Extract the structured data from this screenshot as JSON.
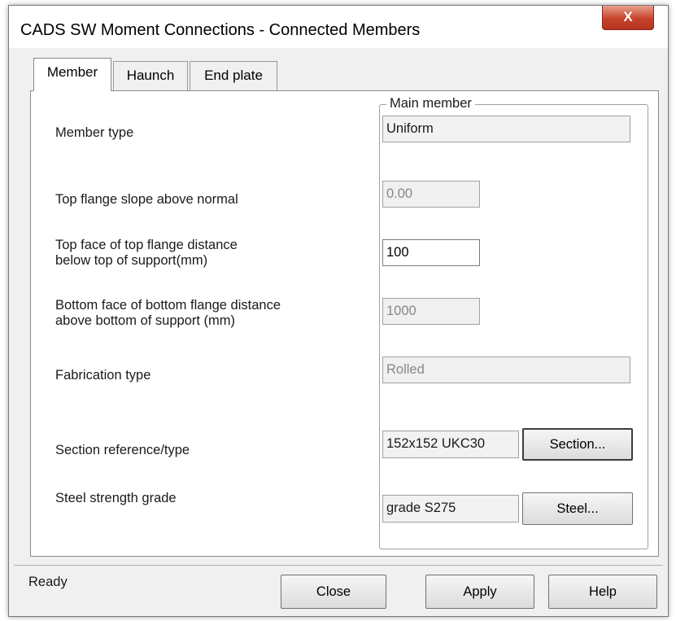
{
  "window": {
    "title": "CADS SW Moment Connections - Connected Members",
    "close_glyph": "X"
  },
  "tabs": [
    {
      "label": "Member",
      "active": true
    },
    {
      "label": "Haunch",
      "active": false
    },
    {
      "label": "End plate",
      "active": false
    }
  ],
  "group": {
    "title": "Main member"
  },
  "fields": {
    "member_type": {
      "label": "Member  type",
      "value": "Uniform"
    },
    "top_flange_slope": {
      "label": "Top flange slope above normal",
      "value": "0.00"
    },
    "top_face_distance": {
      "label_line1": "Top face of top flange distance",
      "label_line2": "below top of support(mm)",
      "value": "100"
    },
    "bottom_face_distance": {
      "label_line1": "Bottom face of bottom flange distance",
      "label_line2": "above bottom of support (mm)",
      "value": "1000"
    },
    "fabrication_type": {
      "label": "Fabrication  type",
      "value": "Rolled"
    },
    "section_reference": {
      "label": "Section reference/type",
      "value": "152x152 UKC30",
      "button": "Section..."
    },
    "steel_grade": {
      "label": "Steel strength grade",
      "value": "grade S275",
      "button": "Steel..."
    }
  },
  "status": "Ready",
  "buttons": {
    "close": "Close",
    "apply": "Apply",
    "help": "Help"
  }
}
